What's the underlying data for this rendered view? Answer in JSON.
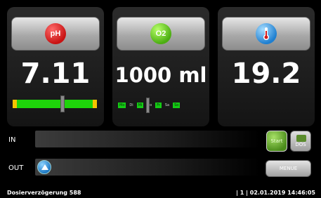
{
  "sensors": [
    {
      "badge": "pH",
      "value": "7.11",
      "icon": "ph-icon"
    },
    {
      "badge": "O2",
      "value": "1000 ml",
      "icon": "o2-icon"
    },
    {
      "badge": "",
      "value": "19.2",
      "icon": "thermometer-icon"
    }
  ],
  "weekdays": [
    "Mo",
    "Di",
    "Mi",
    "Do",
    "Fr",
    "Sa",
    "So"
  ],
  "channels": {
    "in_label": "IN",
    "out_label": "OUT"
  },
  "buttons": {
    "start": "Start",
    "dos": "DOS",
    "menu": "MENUE"
  },
  "status": {
    "message": "Dosierverzögerung 588",
    "right": "| 1 | 02.01.2019 14:46:05"
  },
  "colors": {
    "ph_bar": "#1ed40a",
    "ph_bar_ends": "#f5c400",
    "weekday_on": "#14cc14"
  }
}
